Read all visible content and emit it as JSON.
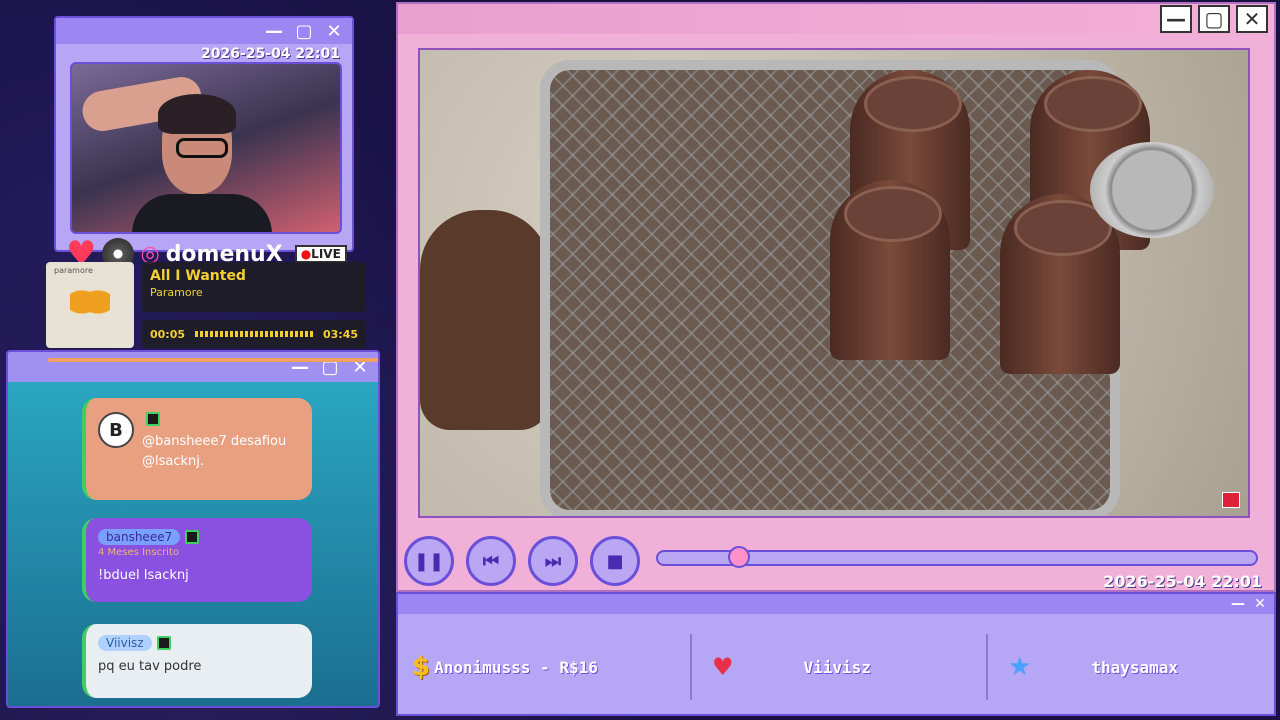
{
  "webcam": {
    "timestamp": "2026-25-04 22:01",
    "username": "domenuX",
    "live_label": "LIVE"
  },
  "music": {
    "album": "paramore",
    "title": "All I Wanted",
    "artist": "Paramore",
    "elapsed": "00:05",
    "duration": "03:45"
  },
  "chat": {
    "messages": [
      {
        "user": "",
        "text": "@bansheee7 desafiou @lsacknj."
      },
      {
        "user": "bansheee7",
        "subtitle": "4 Meses Inscrito",
        "text": "!bduel Isacknj"
      },
      {
        "user": "Viivisz",
        "text": "pq eu tav podre"
      }
    ]
  },
  "video": {
    "timestamp": "2026-25-04 22:01",
    "progress": 0.12
  },
  "alerts": {
    "donation": "Anonimusss - R$16",
    "follower": "Viivisz",
    "subscriber": "thaysamax"
  },
  "icons": {
    "dollar": "dollar-icon",
    "heart": "heart-icon",
    "star": "star-icon"
  },
  "colors": {
    "accent": "#6b4fd8",
    "window_bg": "#b7a6f5",
    "video_frame": "#f0b0d8"
  }
}
